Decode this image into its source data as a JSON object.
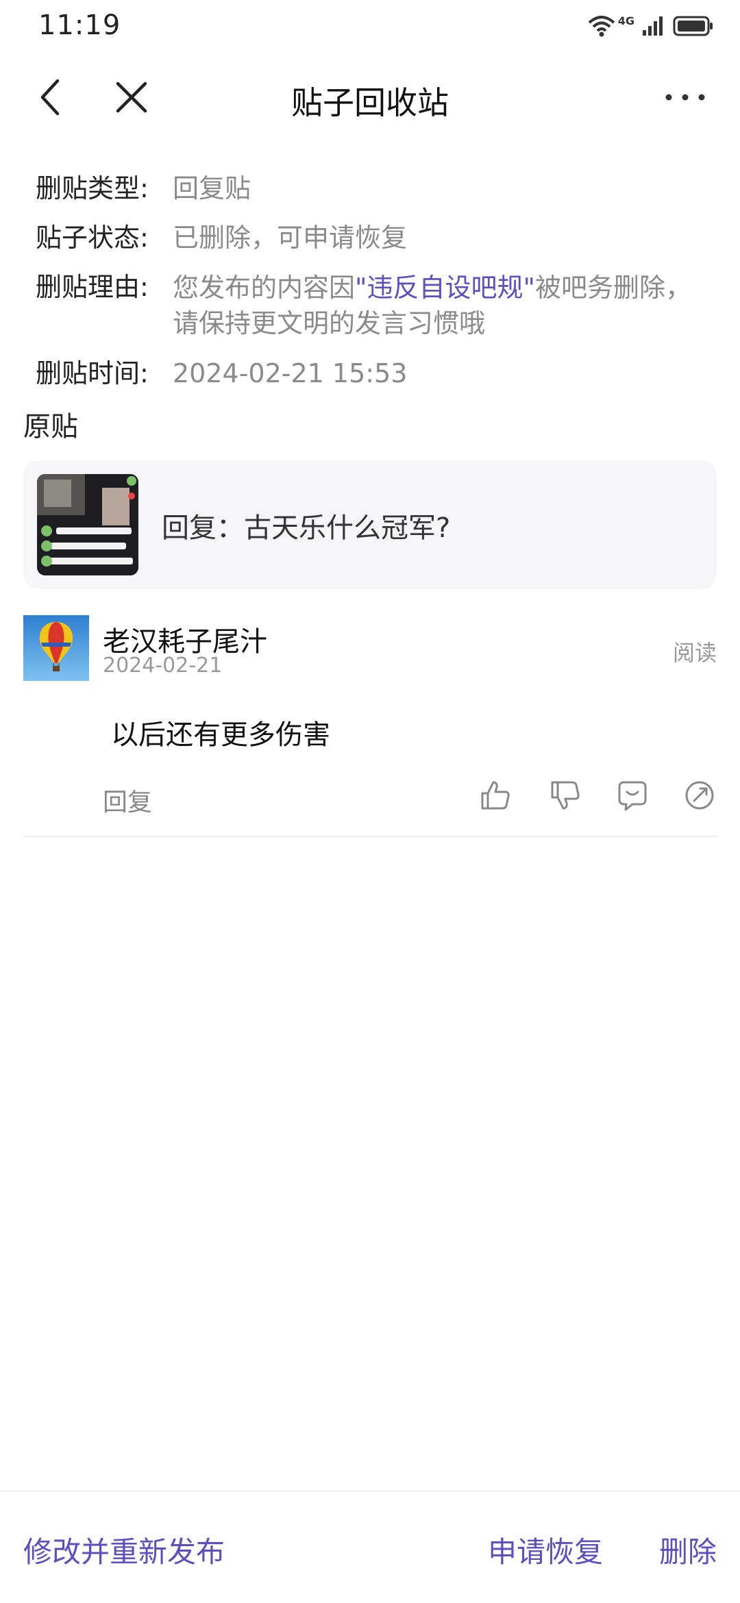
{
  "status_bar": {
    "time": "11:19",
    "network": "4G",
    "icons": [
      "wifi-icon",
      "signal-icon",
      "battery-icon"
    ]
  },
  "nav": {
    "title": "贴子回收站",
    "back_icon": "chevron-left-icon",
    "close_icon": "close-icon",
    "more_icon": "more-icon"
  },
  "info": {
    "type_label": "删贴类型:",
    "type_value": "回复贴",
    "status_label": "贴子状态:",
    "status_value": "已删除，可申请恢复",
    "reason_label": "删贴理由:",
    "reason_prefix": "您发布的内容因",
    "reason_link": "\"违反自设吧规\"",
    "reason_suffix": "被吧务删除，请保持更文明的发言习惯哦",
    "time_label": "删贴时间:",
    "time_value": "2024-02-21 15:53"
  },
  "original": {
    "section_label": "原贴",
    "title": "回复：古天乐什么冠军?"
  },
  "post": {
    "author": "老汉耗子尾汁",
    "date": "2024-02-21",
    "read_label": "阅读",
    "content": "以后还有更多伤害",
    "reply_label": "回复",
    "action_icons": [
      "thumbs-up-icon",
      "thumbs-down-icon",
      "comment-icon",
      "share-icon"
    ]
  },
  "bottom_bar": {
    "edit_repost": "修改并重新发布",
    "request_restore": "申请恢复",
    "delete": "删除"
  },
  "colors": {
    "accent": "#5b4fc2",
    "muted_text": "#8a8a8e",
    "card_bg": "#f6f6f8"
  }
}
